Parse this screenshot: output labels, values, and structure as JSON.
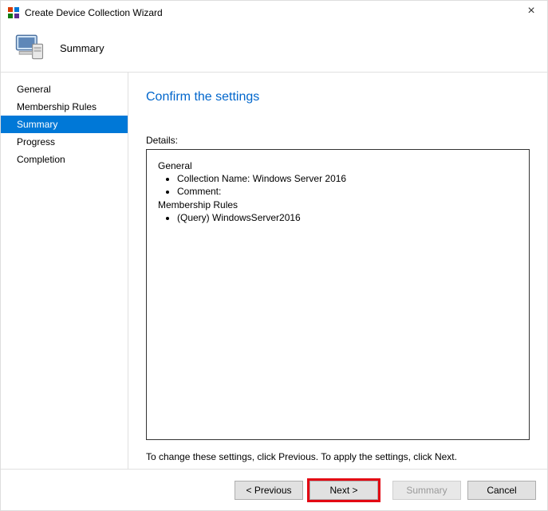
{
  "window": {
    "title": "Create Device Collection Wizard"
  },
  "banner": {
    "step_title": "Summary"
  },
  "sidebar": {
    "items": [
      {
        "label": "General"
      },
      {
        "label": "Membership Rules"
      },
      {
        "label": "Summary"
      },
      {
        "label": "Progress"
      },
      {
        "label": "Completion"
      }
    ],
    "selected_index": 2
  },
  "content": {
    "heading": "Confirm the settings",
    "details_label": "Details:",
    "details": {
      "sections": [
        {
          "title": "General",
          "bullets": [
            "Collection Name: Windows Server 2016",
            "Comment:"
          ]
        },
        {
          "title": "Membership Rules",
          "bullets": [
            "(Query) WindowsServer2016"
          ]
        }
      ]
    },
    "hint": "To change these settings, click Previous. To apply the settings, click Next."
  },
  "buttons": {
    "previous": "< Previous",
    "next": "Next >",
    "summary": "Summary",
    "cancel": "Cancel"
  }
}
